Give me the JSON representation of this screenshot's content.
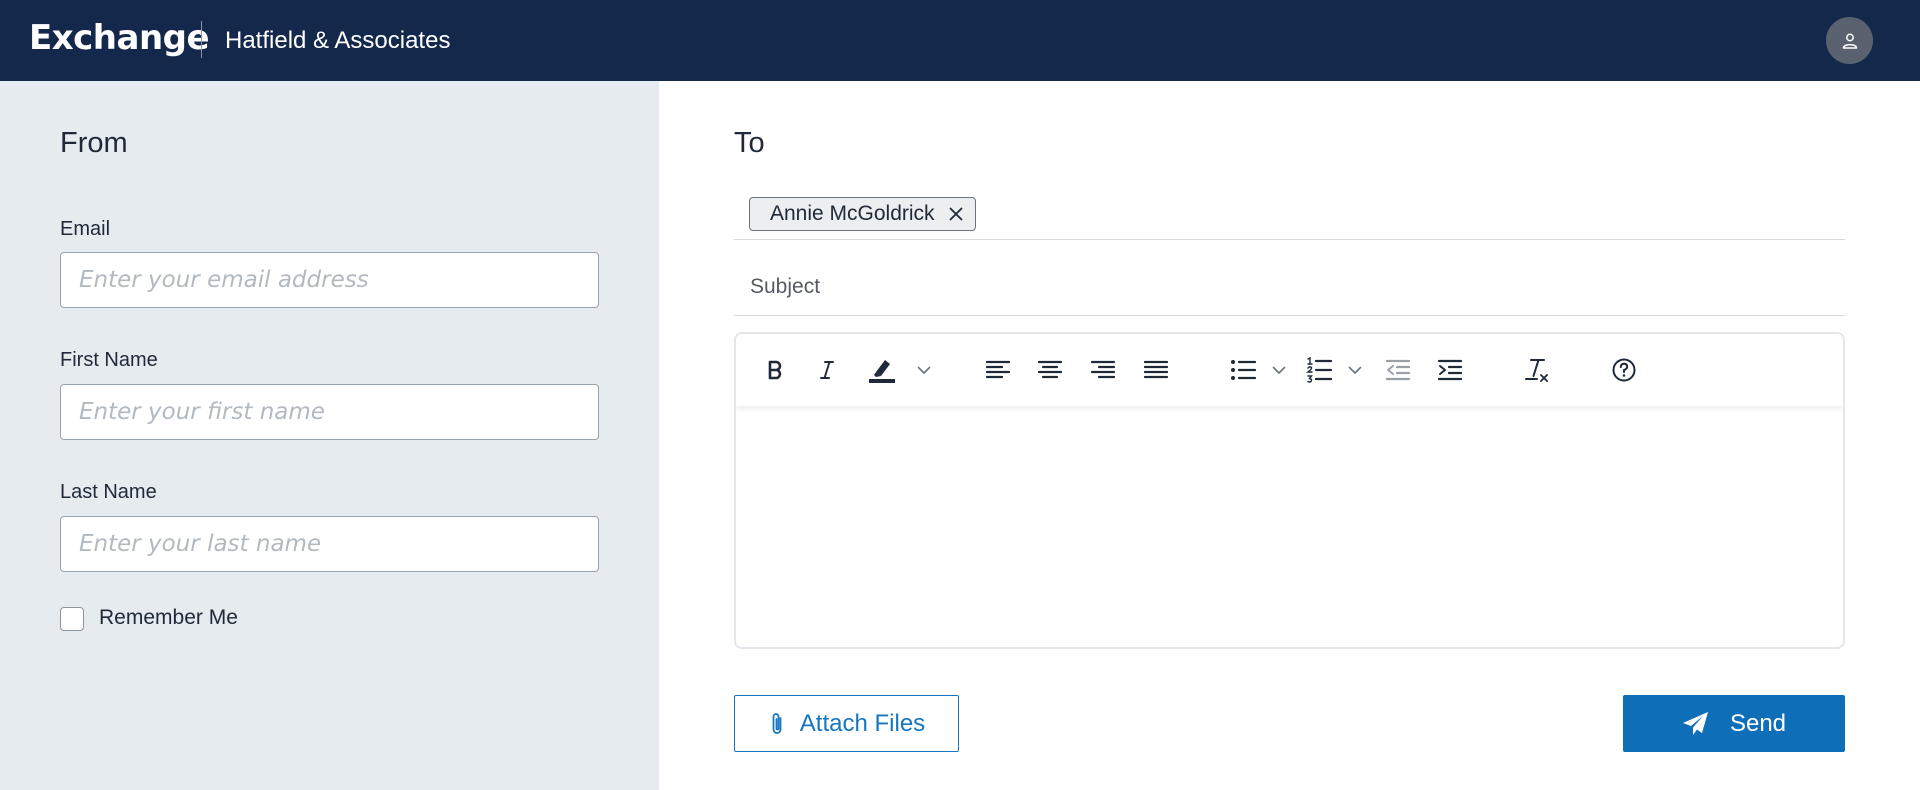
{
  "header": {
    "brand": "Exchange",
    "org_name": "Hatfield & Associates",
    "avatar_icon": "user-icon"
  },
  "from": {
    "title": "From",
    "email": {
      "label": "Email",
      "placeholder": "Enter your email address",
      "value": ""
    },
    "first_name": {
      "label": "First Name",
      "placeholder": "Enter your first name",
      "value": ""
    },
    "last_name": {
      "label": "Last Name",
      "placeholder": "Enter your last name",
      "value": ""
    },
    "remember_me": {
      "label": "Remember Me",
      "checked": false
    }
  },
  "to": {
    "title": "To",
    "recipients": [
      {
        "name": "Annie McGoldrick"
      }
    ],
    "subject": {
      "placeholder": "Subject",
      "value": ""
    }
  },
  "editor": {
    "toolbar_icons": [
      "bold-icon",
      "italic-icon",
      "highlight-icon",
      "chevron-down-icon",
      "align-left-icon",
      "align-center-icon",
      "align-right-icon",
      "align-justify-icon",
      "bulleted-list-icon",
      "chevron-down-icon",
      "numbered-list-icon",
      "chevron-down-icon",
      "outdent-icon",
      "indent-icon",
      "clear-formatting-icon",
      "help-icon"
    ],
    "body": ""
  },
  "actions": {
    "attach_label": "Attach Files",
    "send_label": "Send"
  },
  "colors": {
    "header_bg": "#14284b",
    "left_pane_bg": "#e6ebf0",
    "primary": "#0f6eb8",
    "attach_border": "#1676be"
  }
}
